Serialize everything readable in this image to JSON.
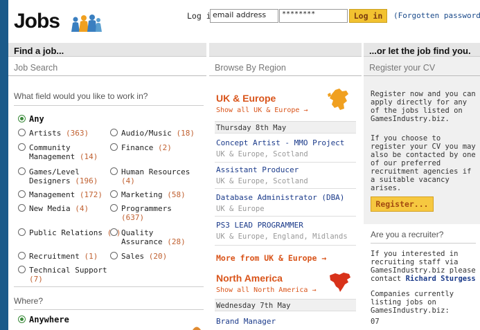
{
  "header": {
    "logo_text": "Jobs",
    "login_label": "Log in",
    "email_value": "email address",
    "password_value": "********",
    "login_button": "Log in",
    "forgot_link": "(Forgotten password?"
  },
  "left": {
    "strip_title": "Find a job...",
    "section_title": "Job Search",
    "field_question": "What field would you like to work in?",
    "any_label": "Any",
    "fields": [
      {
        "name": "Artists",
        "count": "(363)"
      },
      {
        "name": "Audio/Music",
        "count": "(18)"
      },
      {
        "name": "Community Management",
        "count": "(14)"
      },
      {
        "name": "Finance",
        "count": "(2)"
      },
      {
        "name": "Games/Level Designers",
        "count": "(196)"
      },
      {
        "name": "Human Resources",
        "count": "(4)"
      },
      {
        "name": "Management",
        "count": "(172)"
      },
      {
        "name": "Marketing",
        "count": "(58)"
      },
      {
        "name": "New Media",
        "count": "(4)"
      },
      {
        "name": "Programmers",
        "count": "(637)"
      },
      {
        "name": "Public Relations",
        "count": "(5)"
      },
      {
        "name": "Quality Assurance",
        "count": "(28)"
      },
      {
        "name": "Recruitment",
        "count": "(1)"
      },
      {
        "name": "Sales",
        "count": "(20)"
      },
      {
        "name": "Technical Support",
        "count": "(7)"
      }
    ],
    "where_question": "Where?",
    "anywhere_label": "Anywhere"
  },
  "middle": {
    "section_title": "Browse By Region",
    "uk_title": "UK & Europe",
    "uk_show": "Show all UK & Europe →",
    "uk_date": "Thursday 8th May",
    "uk_jobs": [
      {
        "title": "Concept Artist - MMO Project",
        "location": "UK & Europe, Scotland"
      },
      {
        "title": "Assistant Producer",
        "location": "UK & Europe, Scotland"
      },
      {
        "title": "Database Administrator (DBA)",
        "location": "UK & Europe"
      },
      {
        "title": "PS3 LEAD PROGRAMMER",
        "location": "UK & Europe, England, Midlands"
      }
    ],
    "uk_more": "More from UK & Europe →",
    "na_title": "North America",
    "na_show": "Show all North America →",
    "na_date": "Wednesday 7th May",
    "na_jobs": [
      {
        "title": "Brand Manager"
      }
    ]
  },
  "right": {
    "strip_title": "...or let the job find you.",
    "section_title": "Register your CV",
    "para1": "Register now and you can apply directly for any of the jobs listed on GamesIndustry.biz.",
    "para2": "If you choose to register your CV you may also be contacted by one of our preferred recruitment agencies if a suitable vacancy arises.",
    "register_button": "Register...",
    "recruiter_head": "Are you a recruiter?",
    "recruiter_text": "If you interested in recruiting staff via GamesIndustry.biz please contact",
    "contact_name": "Richard Sturgess",
    "companies_text": "Companies currently listing jobs on GamesIndustry.biz:",
    "companies_first": "07"
  },
  "colors": {
    "accent_orange": "#d9541a",
    "link_blue": "#1a3a8a",
    "button_yellow": "#f2c230",
    "count_orange": "#c06030",
    "radio_green": "#3a8a3a",
    "page_backdrop": "#1a5a8a"
  }
}
